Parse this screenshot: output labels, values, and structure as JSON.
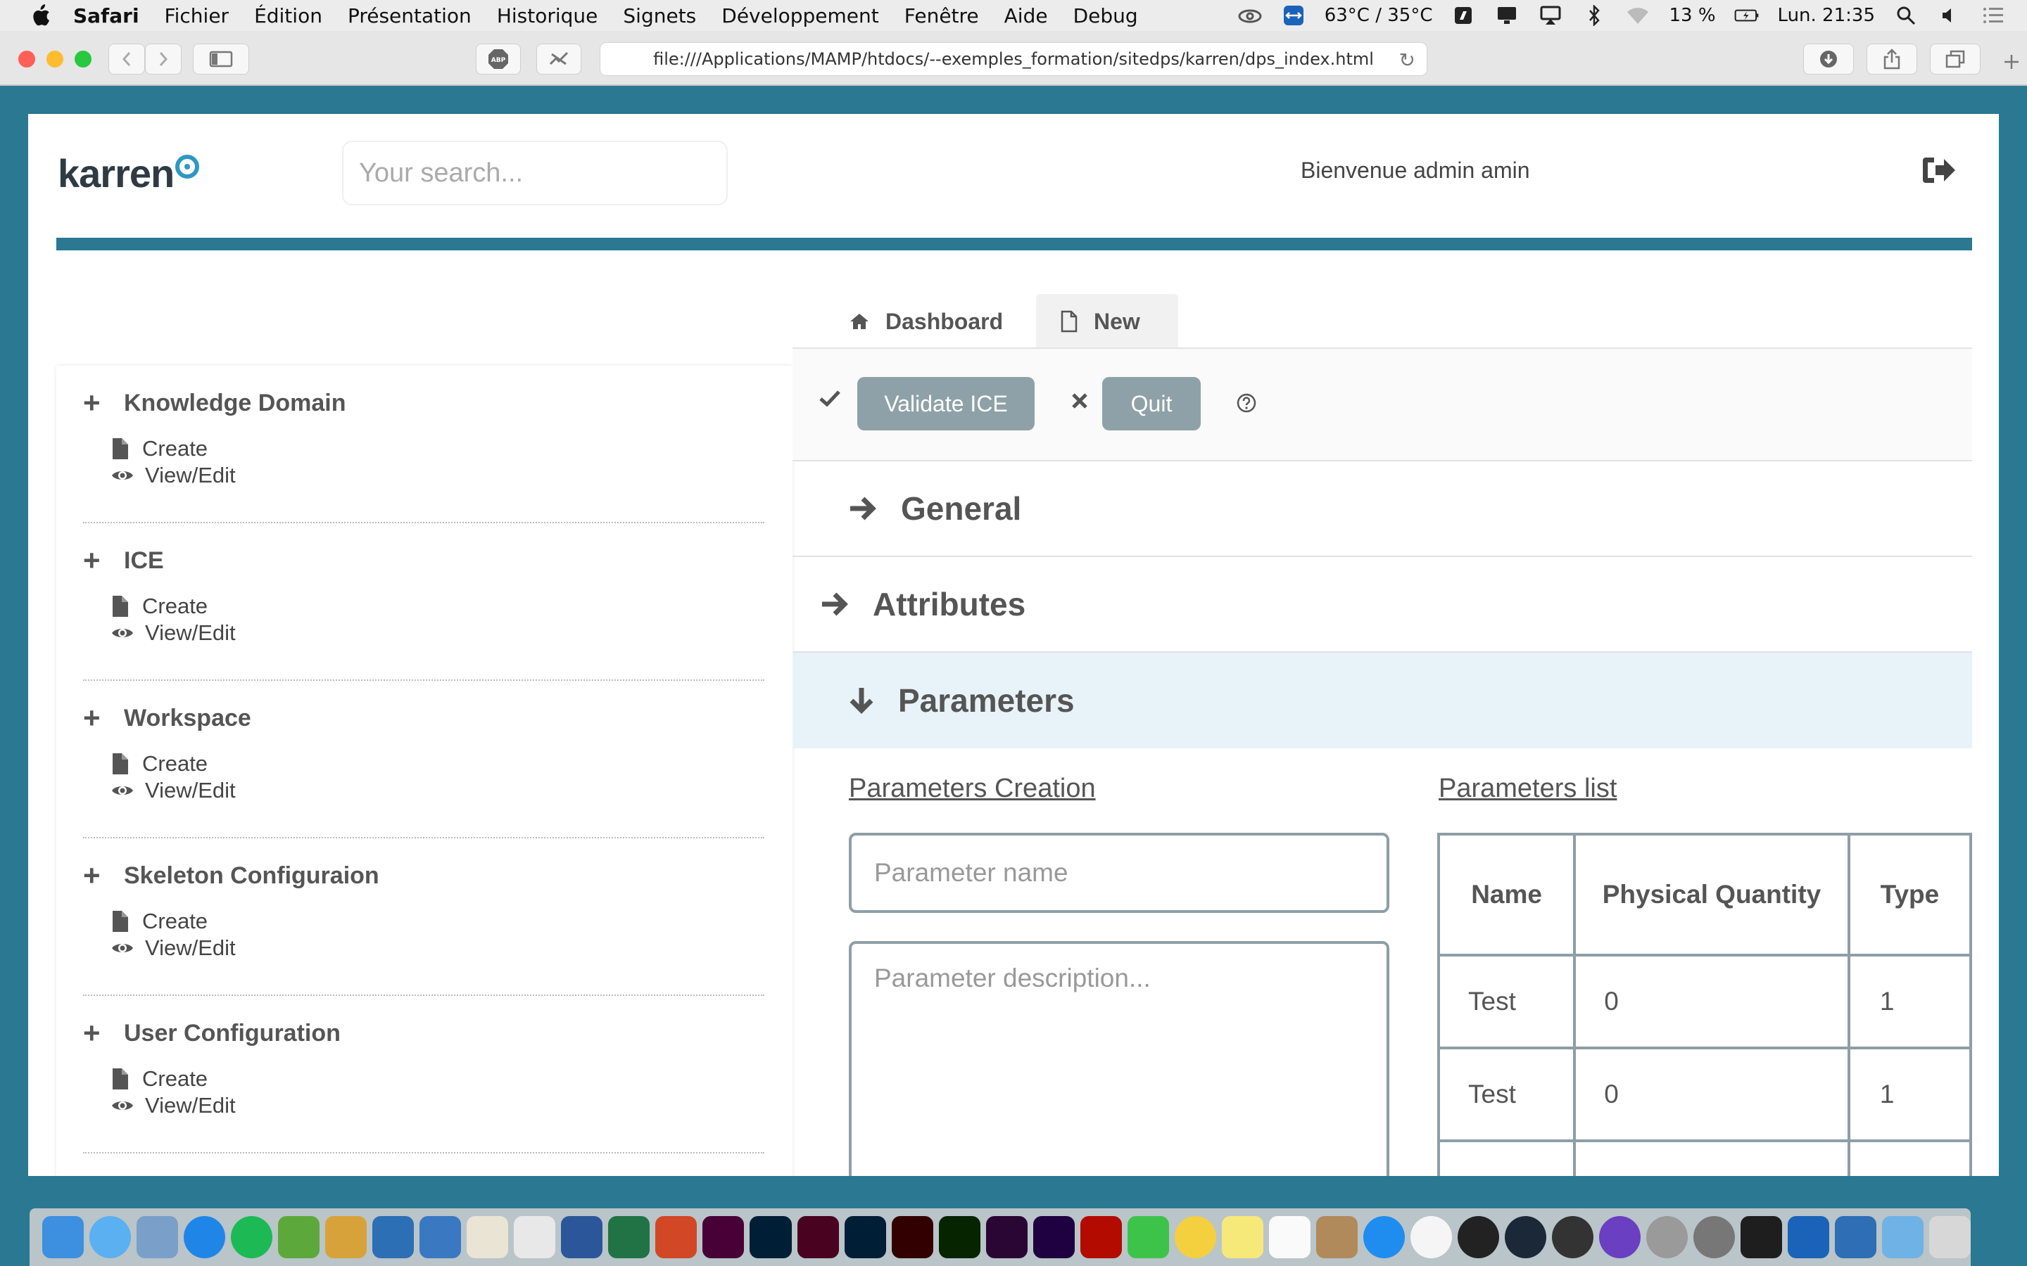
{
  "menubar": {
    "app": "Safari",
    "items": [
      "Fichier",
      "Édition",
      "Présentation",
      "Historique",
      "Signets",
      "Développement",
      "Fenêtre",
      "Aide",
      "Debug"
    ],
    "temperature": "63°C / 35°C",
    "battery": "13 %",
    "clock": "Lun. 21:35"
  },
  "browser": {
    "url": "file:///Applications/MAMP/htdocs/--exemples_formation/sitedps/karren/dps_index.html"
  },
  "header": {
    "logo": "karren",
    "search_placeholder": "Your search...",
    "welcome": "Bienvenue admin amin"
  },
  "sidebar": {
    "sections": [
      {
        "title": "Knowledge Domain",
        "create": "Create",
        "view": "View/Edit"
      },
      {
        "title": "ICE",
        "create": "Create",
        "view": "View/Edit"
      },
      {
        "title": "Workspace",
        "create": "Create",
        "view": "View/Edit"
      },
      {
        "title": "Skeleton Configuraion",
        "create": "Create",
        "view": "View/Edit"
      },
      {
        "title": "User Configuration",
        "create": "Create",
        "view": "View/Edit"
      }
    ]
  },
  "tabs": {
    "dashboard": "Dashboard",
    "new": "New"
  },
  "actions": {
    "validate": "Validate ICE",
    "quit": "Quit"
  },
  "accordion": {
    "general": "General",
    "attributes": "Attributes",
    "parameters": "Parameters"
  },
  "parameters": {
    "creation_title": "Parameters Creation",
    "list_title": "Parameters list",
    "name_placeholder": "Parameter name",
    "description_placeholder": "Parameter description...",
    "table": {
      "headers": [
        "Name",
        "Physical Quantity",
        "Type"
      ],
      "rows": [
        [
          "Test",
          "0",
          "1"
        ],
        [
          "Test",
          "0",
          "1"
        ]
      ]
    }
  },
  "colors": {
    "page_frame": "#2a7891",
    "logo_accent": "#2e98c3",
    "button": "#8fa1a8",
    "highlight_row": "#e8f3f9"
  }
}
